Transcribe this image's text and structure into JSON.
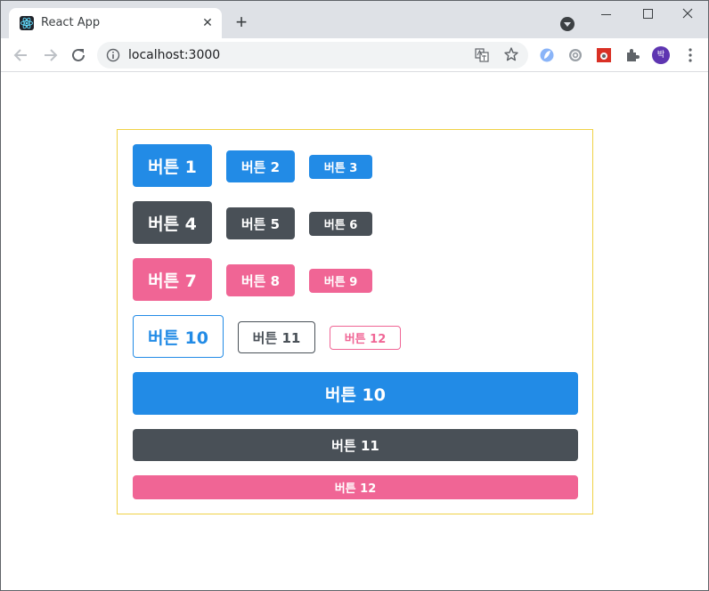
{
  "browser": {
    "tab_title": "React App",
    "tab_close": "✕",
    "new_tab": "+",
    "url": "localhost:3000",
    "avatar_initial": "박"
  },
  "buttons": {
    "row1": [
      "버튼 1",
      "버튼 2",
      "버튼 3"
    ],
    "row2": [
      "버튼 4",
      "버튼 5",
      "버튼 6"
    ],
    "row3": [
      "버튼 7",
      "버튼 8",
      "버튼 9"
    ],
    "row4": [
      "버튼 10",
      "버튼 11",
      "버튼 12"
    ],
    "fullwidth": [
      "버튼 10",
      "버튼 11",
      "버튼 12"
    ]
  },
  "colors": {
    "blue": "#228be6",
    "gray": "#495057",
    "pink": "#f06595",
    "container_border": "#f0d246"
  }
}
